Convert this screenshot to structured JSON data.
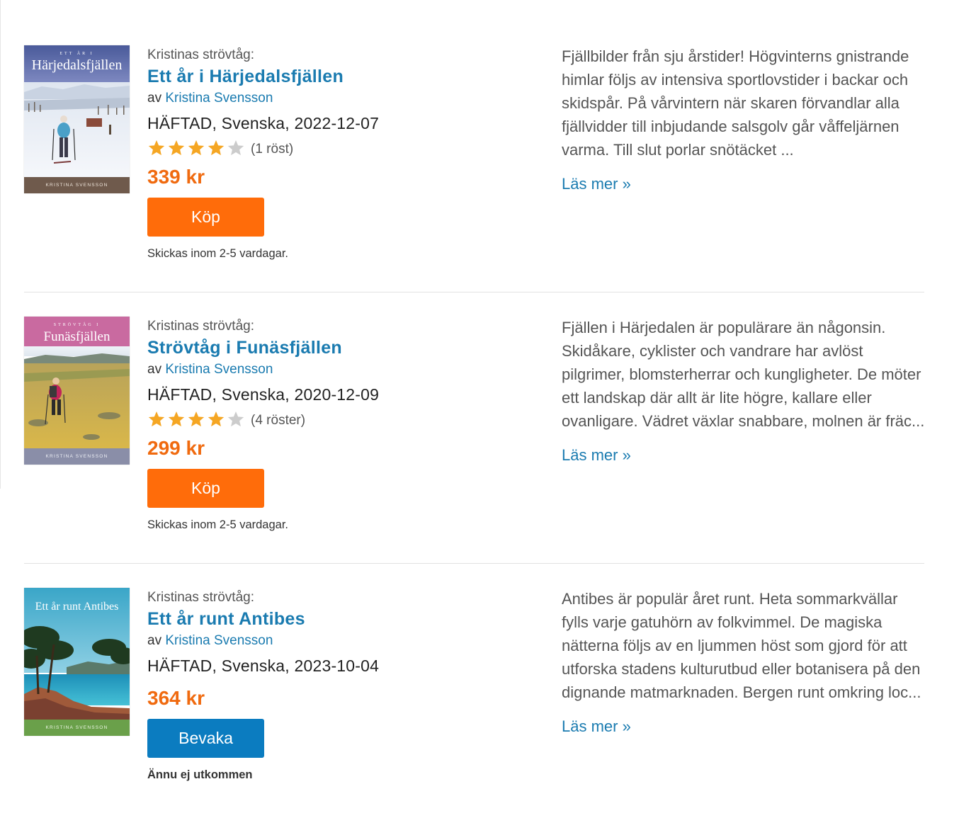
{
  "colors": {
    "link": "#1a7bb0",
    "price": "#f06a0f",
    "buy_button": "#ff6c0a",
    "watch_button": "#0b7cc0",
    "star_filled": "#f5a623",
    "star_empty": "#cccccc"
  },
  "books": [
    {
      "series": "Kristinas strövtåg:",
      "title": "Ett år i Härjedalsfjällen",
      "author_prefix": "av",
      "author": "Kristina Svensson",
      "format": "HÄFTAD",
      "language_date": ", Svenska, 2022-12-07",
      "rating": 4,
      "rating_count": "(1 röst)",
      "price": "339 kr",
      "button_label": "Köp",
      "button_type": "buy",
      "shipping": "Skickas inom 2-5 vardagar.",
      "shipping_bold": false,
      "description": "Fjällbilder från sju årstider! Högvinterns gnistrande himlar följs av intensiva sportlovstider i backar och skidspår. På vårvintern när skaren förvandlar alla fjällvidder till inbjudande salsgolv går våffeljärnen varma. Till slut porlar snötäcket ...",
      "read_more": "Läs mer »",
      "cover": {
        "top_text": "ETT ÅR I",
        "title": "Härjedalsfjällen",
        "author": "KRISTINA SVENSSON",
        "theme": "winter"
      }
    },
    {
      "series": "Kristinas strövtåg:",
      "title": "Strövtåg i Funäsfjällen",
      "author_prefix": "av",
      "author": "Kristina Svensson",
      "format": "HÄFTAD",
      "language_date": ", Svenska, 2020-12-09",
      "rating": 4,
      "rating_count": "(4 röster)",
      "price": "299 kr",
      "button_label": "Köp",
      "button_type": "buy",
      "shipping": "Skickas inom 2-5 vardagar.",
      "shipping_bold": false,
      "description": "Fjällen i Härjedalen är populärare än någonsin. Skidåkare, cyklister och vandrare har avlöst pilgrimer, blomsterherrar och kungligheter. De möter ett landskap där allt är lite högre, kallare eller ovanligare. Vädret växlar snabbare, molnen är fräc...",
      "read_more": "Läs mer »",
      "cover": {
        "top_text": "STRÖVTÅG I",
        "title": "Funäsfjällen",
        "author": "KRISTINA SVENSSON",
        "theme": "summer"
      }
    },
    {
      "series": "Kristinas strövtåg:",
      "title": "Ett år runt Antibes",
      "author_prefix": "av",
      "author": "Kristina Svensson",
      "format": "HÄFTAD",
      "language_date": ", Svenska, 2023-10-04",
      "rating": null,
      "rating_count": "",
      "price": "364 kr",
      "button_label": "Bevaka",
      "button_type": "watch",
      "shipping": "Ännu ej utkommen",
      "shipping_bold": true,
      "description": "Antibes är populär året runt. Heta sommarkvällar fylls varje gatuhörn av folkvimmel. De magiska nätterna följs av en ljummen höst som gjord för att utforska stadens kulturutbud eller botanisera på den dignande matmarknaden. Bergen runt omkring loc...",
      "read_more": "Läs mer »",
      "cover": {
        "top_text": "",
        "title": "Ett år runt Antibes",
        "author": "KRISTINA SVENSSON",
        "theme": "coast"
      }
    }
  ]
}
